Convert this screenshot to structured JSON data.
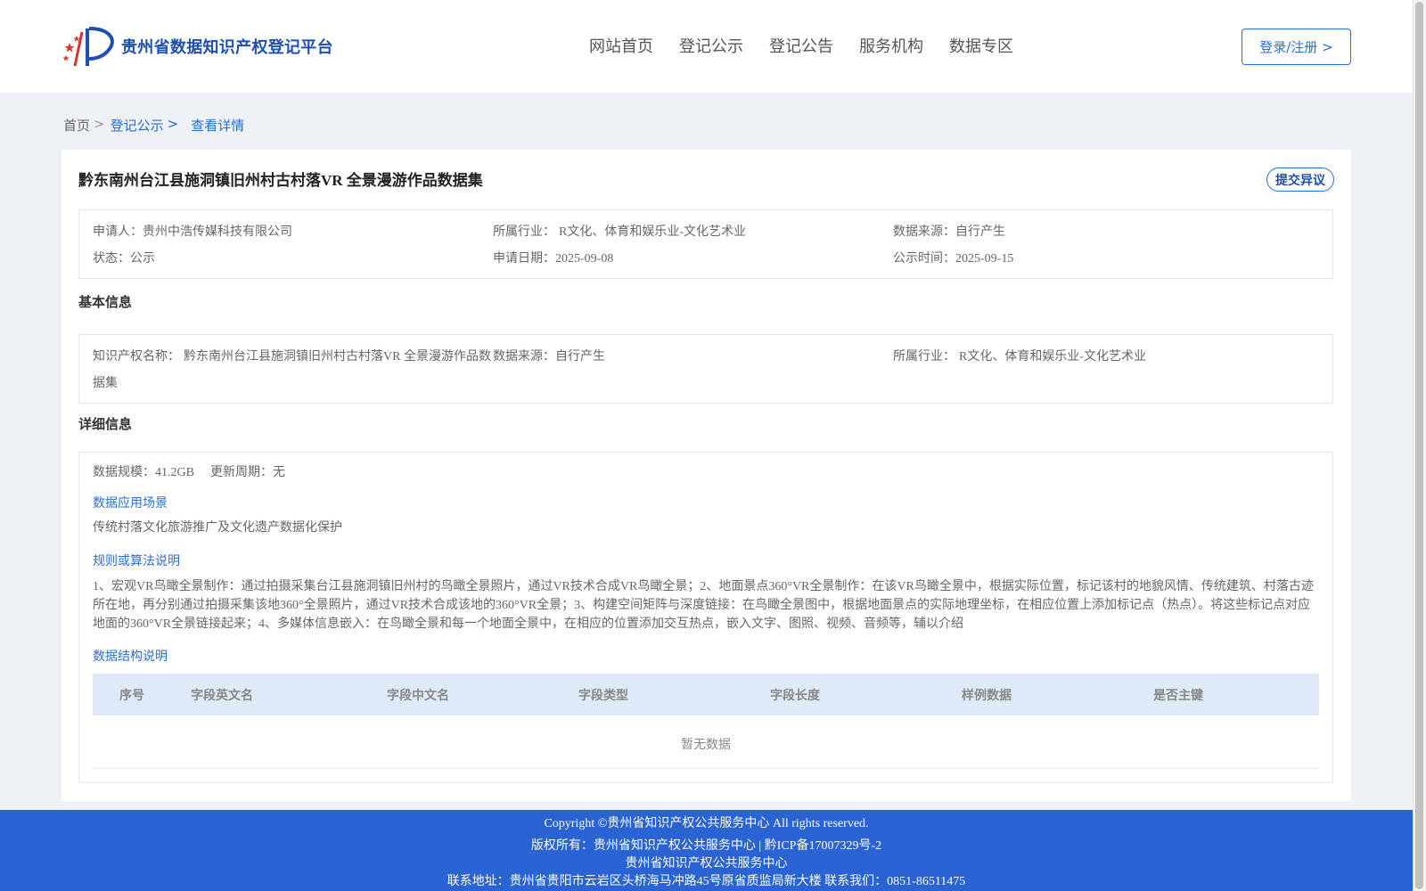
{
  "header": {
    "logo_text": "贵州省数据知识产权登记平台",
    "nav": [
      "网站首页",
      "登记公示",
      "登记公告",
      "服务机构",
      "数据专区"
    ],
    "login_label": "登录/注册 >"
  },
  "breadcrumb": {
    "home": "首页",
    "list": "登记公示",
    "current": "查看详情",
    "separator": ">"
  },
  "record": {
    "title": "黔东南州台江县施洞镇旧州村古村落VR 全景漫游作品数据集",
    "objection_label": "提交异议",
    "summary": {
      "applicant_label": "申请人：",
      "applicant": "贵州中浩传媒科技有限公司",
      "industry_label": "所属行业：",
      "industry": "R文化、体育和娱乐业-文化艺术业",
      "source_label": "数据来源：",
      "source": "自行产生",
      "status_label": "状态：",
      "status": "公示",
      "apply_date_label": "申请日期：",
      "apply_date": "2025-09-08",
      "publish_date_label": "公示时间：",
      "publish_date": "2025-09-15"
    }
  },
  "basic": {
    "section_title": "基本信息",
    "ip_name_label": "知识产权名称：",
    "ip_name_line1": "黔东南州台江县施洞镇旧州村古村落VR 全景漫游作品数",
    "ip_name_line2": "据集",
    "source_label": "数据来源：",
    "source": "自行产生",
    "industry_label": "所属行业：",
    "industry": "R文化、体育和娱乐业-文化艺术业"
  },
  "detail": {
    "section_title": "详细信息",
    "scale_label": "数据规模：",
    "scale": "41.2GB",
    "cycle_label": "更新周期：",
    "cycle": "无",
    "scenario_title": "数据应用场景",
    "scenario_text": "传统村落文化旅游推广及文化遗产数据化保护",
    "rules_title": "规则或算法说明",
    "rules_line1": "1、宏观VR鸟瞰全景制作：通过拍摄采集台江县施洞镇旧州村的鸟瞰全景照片，通过VR技术合成VR鸟瞰全景；2、地面景点360°VR全景制作：在该VR鸟瞰全景中，根据实际位置，标记该村的地貌风情、传统建筑、村落古迹",
    "rules_line2": "所在地，再分别通过拍摄采集该地360°全景照片，通过VR技术合成该地的360°VR全景；3、构建空间矩阵与深度链接：在鸟瞰全景图中，根据地面景点的实际地理坐标，在相应位置上添加标记点（热点）。将这些标记点对应",
    "rules_line3": "地面的360°VR全景链接起来；4、多媒体信息嵌入：在鸟瞰全景和每一个地面全景中，在相应的位置添加交互热点，嵌入文字、图照、视频、音频等，辅以介绍",
    "structure_title": "数据结构说明",
    "table_headers": [
      "序号",
      "字段英文名",
      "字段中文名",
      "字段类型",
      "字段长度",
      "样例数据",
      "是否主键"
    ],
    "empty_text": "暂无数据"
  },
  "footer": {
    "copyright": "Copyright ©贵州省知识产权公共服务中心 All rights reserved.",
    "owner": "版权所有：贵州省知识产权公共服务中心 | 黔ICP备17007329号-2",
    "org": "贵州省知识产权公共服务中心",
    "contact": "联系地址：贵州省贵阳市云岩区头桥海马冲路45号原省质监局新大楼 联系我们：0851-86511475"
  },
  "colors": {
    "brand": "#1f4fb0",
    "link": "#2a6fd6",
    "footer_bg": "#2a63d4",
    "table_head_bg": "#dfeaf8"
  }
}
